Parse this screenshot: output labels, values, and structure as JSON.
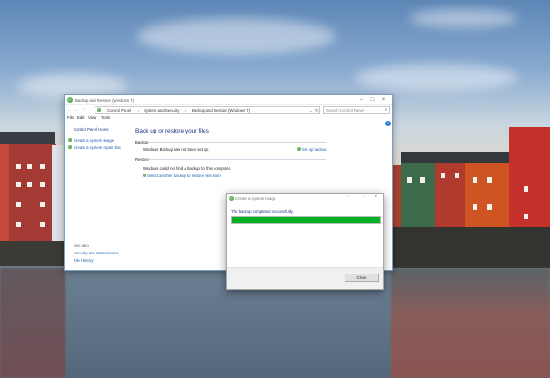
{
  "window": {
    "title": "Backup and Restore (Windows 7)",
    "breadcrumb": [
      "Control Panel",
      "System and Security",
      "Backup and Restore (Windows 7)"
    ],
    "search_placeholder": "Search Control Panel",
    "menu": [
      "File",
      "Edit",
      "View",
      "Tools"
    ]
  },
  "left_nav": {
    "home": "Control Panel Home",
    "links": [
      "Create a system image",
      "Create a system repair disc"
    ],
    "see_also_heading": "See also",
    "see_also": [
      "Security and Maintenance",
      "File History"
    ]
  },
  "main": {
    "title": "Back up or restore your files",
    "backup_heading": "Backup",
    "backup_status": "Windows Backup has not been set up.",
    "setup_link": "Set up backup",
    "restore_heading": "Restore",
    "restore_status": "Windows could not find a backup for this computer.",
    "restore_link": "Select another backup to restore files from"
  },
  "dialog": {
    "title": "Create a system image",
    "message": "The backup completed successfully.",
    "progress": 1.0,
    "close_label": "Close"
  },
  "colors": {
    "progress": "#06b025",
    "link": "#1a5aaf",
    "heading": "#1e3287"
  },
  "icons": [
    "app-icon",
    "back-arrow-icon",
    "forward-arrow-icon",
    "up-arrow-icon",
    "refresh-icon",
    "search-icon",
    "chevron-down-icon",
    "minimize-icon",
    "maximize-icon",
    "close-icon",
    "shield-icon",
    "backup-icon",
    "help-icon"
  ]
}
